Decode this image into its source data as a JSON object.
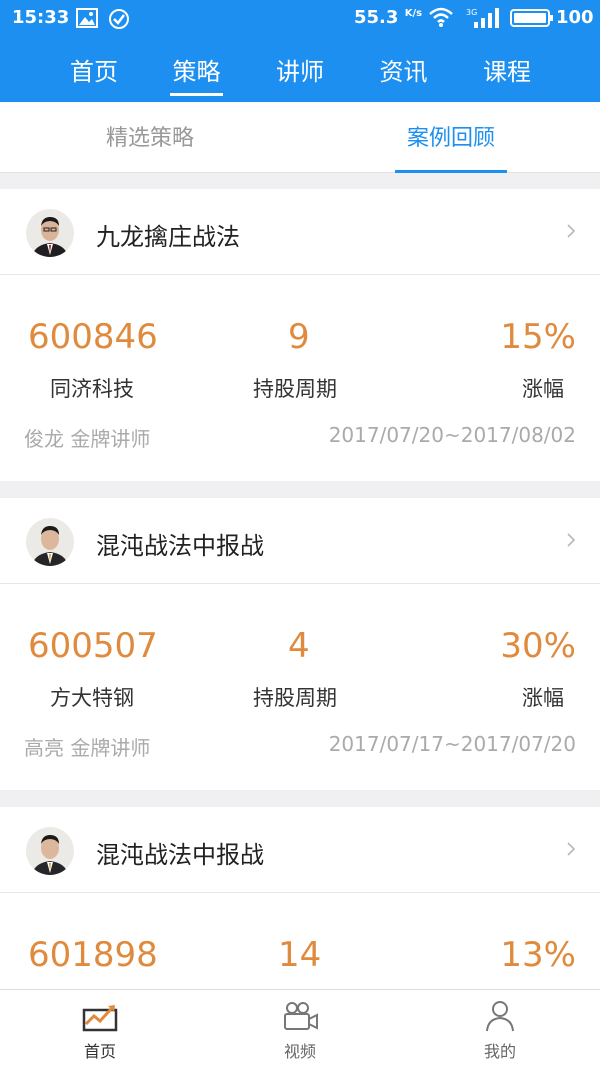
{
  "status_bar": {
    "time": "15:33",
    "speed": "55.3",
    "speed_unit": "K/s",
    "network": "3G",
    "battery": "100"
  },
  "top_nav": {
    "tabs": [
      "首页",
      "策略",
      "讲师",
      "资讯",
      "课程"
    ],
    "active": "策略"
  },
  "sub_tabs": {
    "tabs": [
      "精选策略",
      "案例回顾"
    ],
    "active": "案例回顾"
  },
  "cases": [
    {
      "strategy": "九龙擒庄战法",
      "code": "600846",
      "stock_name": "同济科技",
      "period_value": "9",
      "period_label": "持股周期",
      "gain_value": "15%",
      "gain_label": "涨幅",
      "teacher": "俊龙 金牌讲师",
      "date_range": "2017/07/20~2017/08/02"
    },
    {
      "strategy": "混沌战法中报战",
      "code": "600507",
      "stock_name": "方大特钢",
      "period_value": "4",
      "period_label": "持股周期",
      "gain_value": "30%",
      "gain_label": "涨幅",
      "teacher": "高亮 金牌讲师",
      "date_range": "2017/07/17~2017/07/20"
    },
    {
      "strategy": "混沌战法中报战",
      "code": "601898",
      "period_value": "14",
      "gain_value": "13%"
    }
  ],
  "bottom_nav": {
    "items": [
      {
        "label": "首页",
        "icon": "chart-icon"
      },
      {
        "label": "视频",
        "icon": "video-camera-icon"
      },
      {
        "label": "我的",
        "icon": "person-icon"
      }
    ],
    "active": "首页"
  },
  "colors": {
    "primary": "#1c8ff0",
    "value_orange": "#e08a3e",
    "muted": "#aaaaaa"
  }
}
